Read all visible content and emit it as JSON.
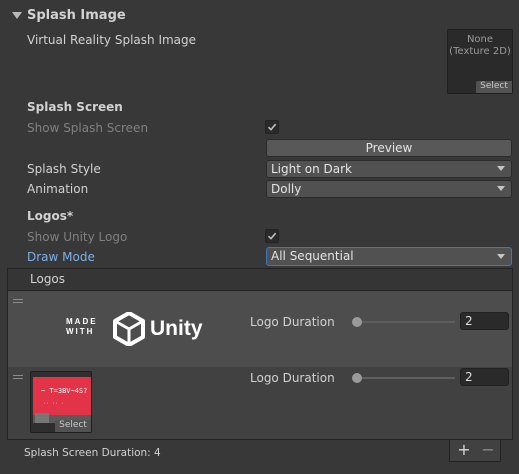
{
  "section": {
    "title": "Splash Image"
  },
  "vr_splash": {
    "label": "Virtual Reality Splash Image",
    "texture_text_line1": "None",
    "texture_text_line2": "(Texture 2D)",
    "select_label": "Select"
  },
  "splash_screen": {
    "header": "Splash Screen",
    "show_label": "Show Splash Screen",
    "show_checked": true,
    "preview_label": "Preview",
    "style_label": "Splash Style",
    "style_value": "Light on Dark",
    "animation_label": "Animation",
    "animation_value": "Dolly"
  },
  "logos_section": {
    "header": "Logos*",
    "show_unity_label": "Show Unity Logo",
    "show_unity_checked": true,
    "draw_mode_label": "Draw Mode",
    "draw_mode_value": "All Sequential"
  },
  "logos_list": {
    "header": "Logos",
    "items": [
      {
        "made_with": "MADE WITH",
        "brand": "Unity",
        "duration_label": "Logo Duration",
        "duration_value": "2",
        "slider_fraction": 0.0
      },
      {
        "select_label": "Select",
        "duration_label": "Logo Duration",
        "duration_value": "2",
        "slider_fraction": 0.0
      }
    ]
  },
  "footer": {
    "total_duration": "Splash Screen Duration: 4",
    "add_label": "+",
    "remove_label": "−"
  }
}
